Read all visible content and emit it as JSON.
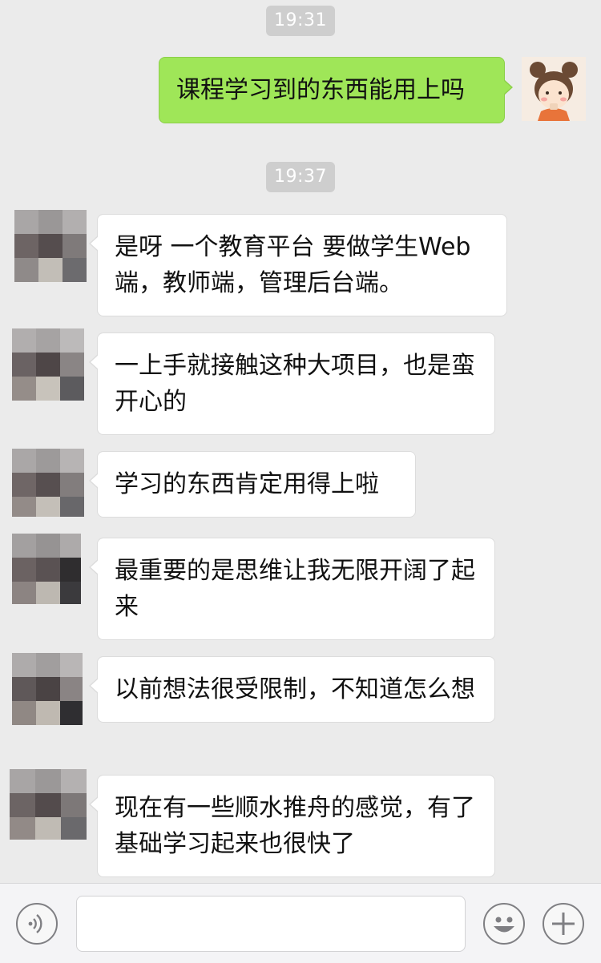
{
  "timestamps": [
    "19:31",
    "19:37"
  ],
  "messages": [
    {
      "side": "right",
      "text": "课程学习到的东西能用上吗"
    },
    {
      "side": "left",
      "text": "是呀 一个教育平台 要做学生Web端，教师端，管理后台端。"
    },
    {
      "side": "left",
      "text": "一上手就接触这种大项目，也是蛮开心的"
    },
    {
      "side": "left",
      "text": "学习的东西肯定用得上啦"
    },
    {
      "side": "left",
      "text": "最重要的是思维让我无限开阔了起来"
    },
    {
      "side": "left",
      "text": "以前想法很受限制，不知道怎么想"
    },
    {
      "side": "left",
      "text": "现在有一些顺水推舟的感觉，有了基础学习起来也很快了"
    }
  ],
  "input_bar": {
    "voice_icon": "voice-icon",
    "emoji_icon": "emoji-icon",
    "plus_icon": "plus-icon",
    "text_value": ""
  },
  "colors": {
    "background": "#ebebeb",
    "sent_bubble": "#9fe658",
    "received_bubble": "#ffffff"
  }
}
